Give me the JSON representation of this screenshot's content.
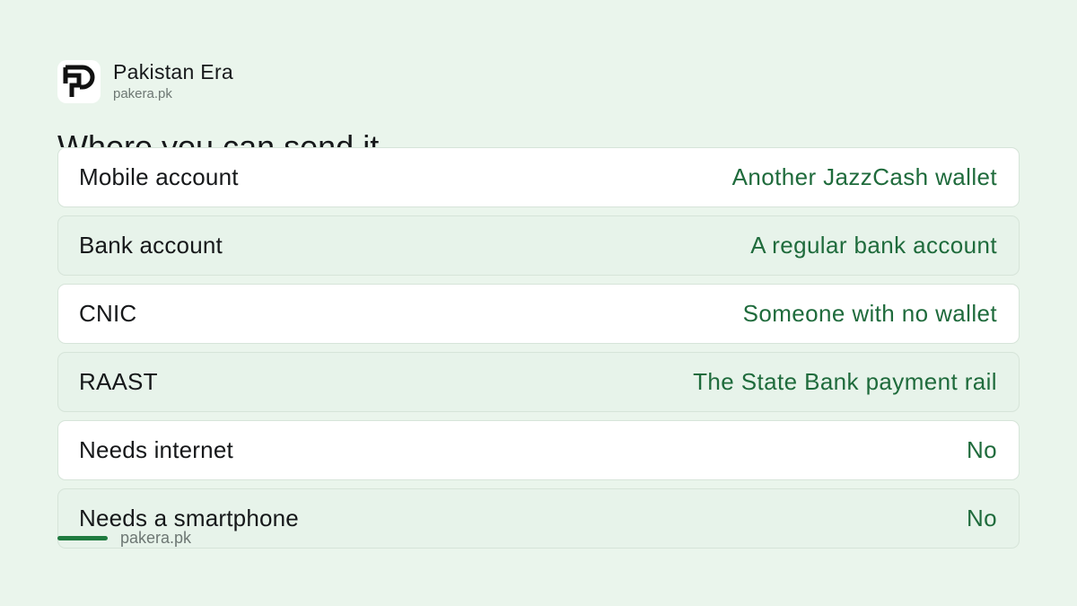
{
  "brand": {
    "name": "Pakistan Era",
    "domain": "pakera.pk",
    "logo_icon": "pakera-p-logo-icon"
  },
  "section": {
    "title": "Where you can send it"
  },
  "rows": [
    {
      "label": "Mobile account",
      "value": "Another JazzCash wallet"
    },
    {
      "label": "Bank account",
      "value": "A regular bank account"
    },
    {
      "label": "CNIC",
      "value": "Someone with no wallet"
    },
    {
      "label": "RAAST",
      "value": "The State Bank payment rail"
    },
    {
      "label": "Needs internet",
      "value": "No"
    },
    {
      "label": "Needs a smartphone",
      "value": "No"
    }
  ],
  "footer": {
    "domain": "pakera.pk"
  },
  "colors": {
    "background": "#eaf5ec",
    "accent": "#1f7a3f",
    "value_text": "#1f6b3c"
  }
}
